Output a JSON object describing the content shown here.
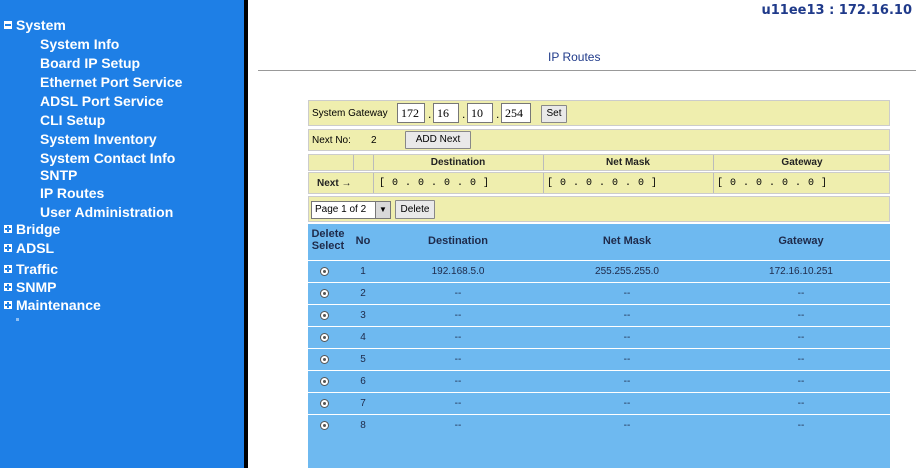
{
  "header": {
    "host": "u11ee13 : 172.16.10",
    "page_title": "IP Routes"
  },
  "sidebar": {
    "system": "System",
    "system_items": [
      "System Info",
      "Board IP Setup",
      "Ethernet Port Service",
      "ADSL Port Service",
      "CLI Setup",
      "System Inventory",
      "System Contact Info",
      "SNTP",
      "IP Routes",
      "User Administration"
    ],
    "groups": [
      "Bridge",
      "ADSL",
      "Traffic",
      "SNMP",
      "Maintenance"
    ]
  },
  "gateway": {
    "label": "System Gateway",
    "octets": [
      "172",
      "16",
      "10",
      "254"
    ],
    "set_label": "Set"
  },
  "next_no": {
    "label": "Next No:",
    "value": "2",
    "add_label": "ADD Next"
  },
  "columns": {
    "destination": "Destination",
    "netmask": "Net Mask",
    "gateway": "Gateway"
  },
  "next_row": {
    "label": "Next →",
    "destination": "[ 0 . 0 . 0 . 0 ]",
    "netmask": "[ 0 . 0 . 0 . 0 ]",
    "gateway": "[ 0 . 0 . 0 . 0 ]"
  },
  "pager": {
    "selected": "Page 1 of 2",
    "delete_label": "Delete"
  },
  "table": {
    "headers": {
      "delete_select": "Delete Select",
      "no": "No",
      "destination": "Destination",
      "netmask": "Net Mask",
      "gateway": "Gateway"
    },
    "rows": [
      {
        "no": "1",
        "destination": "192.168.5.0",
        "netmask": "255.255.255.0",
        "gateway": "172.16.10.251"
      },
      {
        "no": "2",
        "destination": "--",
        "netmask": "--",
        "gateway": "--"
      },
      {
        "no": "3",
        "destination": "--",
        "netmask": "--",
        "gateway": "--"
      },
      {
        "no": "4",
        "destination": "--",
        "netmask": "--",
        "gateway": "--"
      },
      {
        "no": "5",
        "destination": "--",
        "netmask": "--",
        "gateway": "--"
      },
      {
        "no": "6",
        "destination": "--",
        "netmask": "--",
        "gateway": "--"
      },
      {
        "no": "7",
        "destination": "--",
        "netmask": "--",
        "gateway": "--"
      },
      {
        "no": "8",
        "destination": "--",
        "netmask": "--",
        "gateway": "--"
      }
    ]
  },
  "colors": {
    "sidebar": "#1e7fe6",
    "band": "#efeeae",
    "table": "#6eb9f0"
  }
}
